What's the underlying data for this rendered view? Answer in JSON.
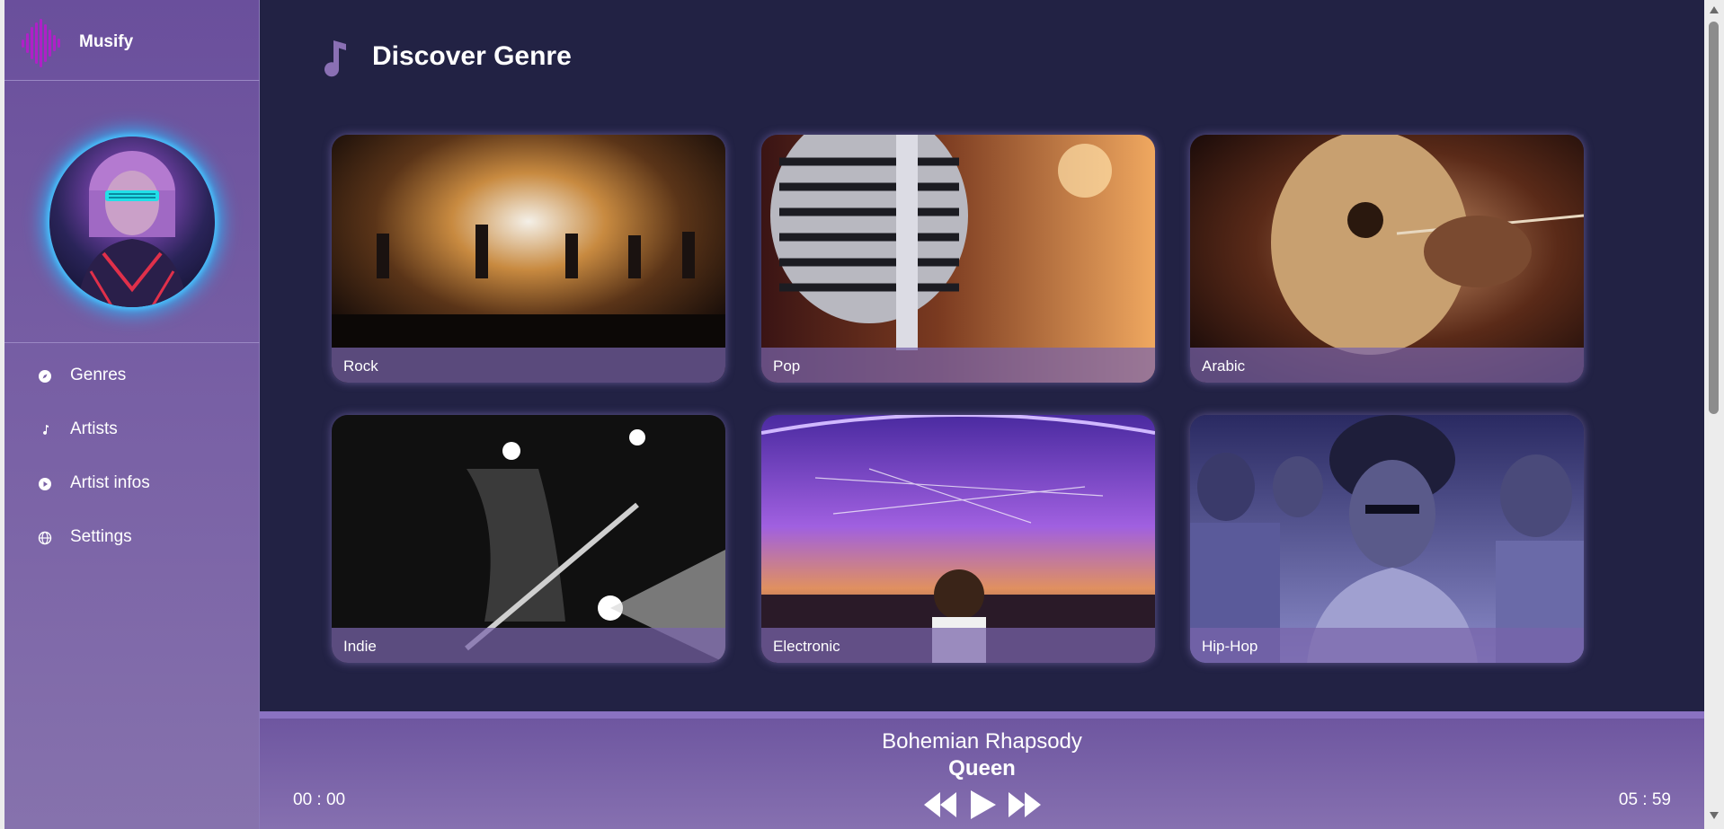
{
  "app": {
    "name": "Musify"
  },
  "sidebar": {
    "items": [
      {
        "label": "Genres",
        "icon": "compass-icon"
      },
      {
        "label": "Artists",
        "icon": "music-note-icon"
      },
      {
        "label": "Artist infos",
        "icon": "play-circle-icon"
      },
      {
        "label": "Settings",
        "icon": "globe-icon"
      }
    ]
  },
  "main": {
    "title": "Discover Genre",
    "title_icon": "music-note-icon",
    "genres": [
      {
        "label": "Rock"
      },
      {
        "label": "Pop"
      },
      {
        "label": "Arabic"
      },
      {
        "label": "Indie"
      },
      {
        "label": "Electronic"
      },
      {
        "label": "Hip-Hop"
      }
    ]
  },
  "player": {
    "title": "Bohemian Rhapsody",
    "artist": "Queen",
    "current_time": "00 : 00",
    "total_time": "05 : 59",
    "controls": [
      "rewind-icon",
      "play-icon",
      "fast-forward-icon"
    ]
  },
  "colors": {
    "background": "#222244",
    "sidebar": "#7a62a6",
    "accent_glow": "#29b8ff",
    "player": "#7a62a6"
  }
}
